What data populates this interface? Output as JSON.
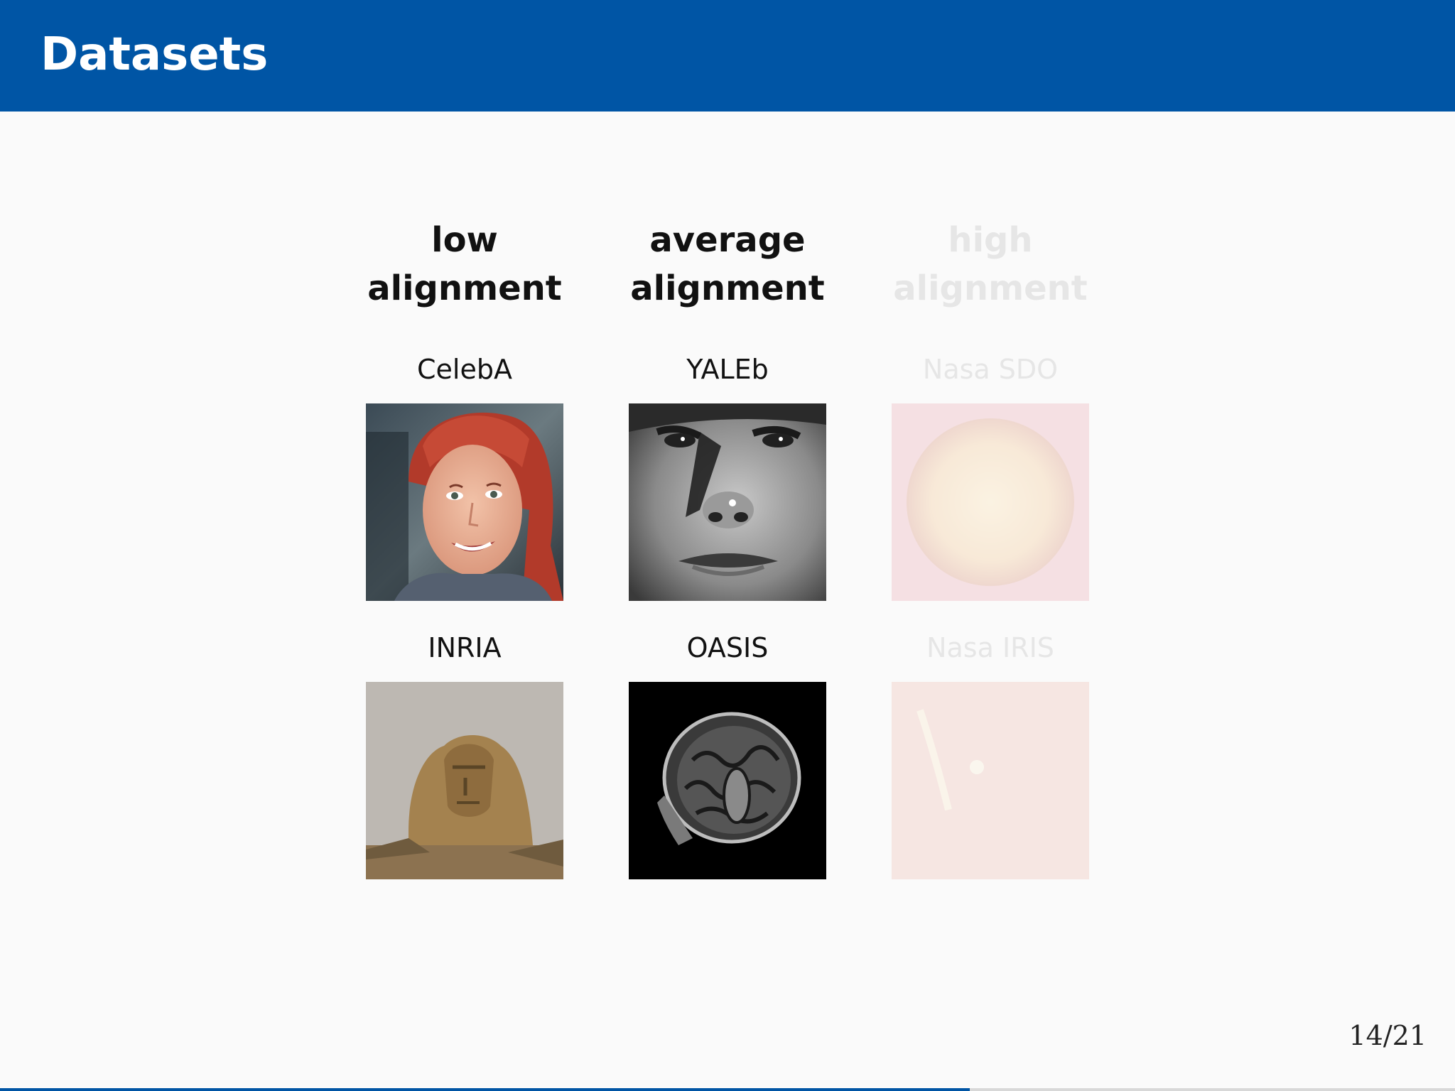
{
  "slide": {
    "title": "Datasets",
    "page_number": "14/21",
    "progress": 0.6667
  },
  "columns": [
    {
      "heading_line1": "low",
      "heading_line2": "alignment",
      "highlighted": true,
      "datasets": [
        {
          "name": "CelebA",
          "image": "woman-face-photo"
        },
        {
          "name": "INRIA",
          "image": "sphinx-photo"
        }
      ]
    },
    {
      "heading_line1": "average",
      "heading_line2": "alignment",
      "highlighted": true,
      "datasets": [
        {
          "name": "YALEb",
          "image": "grayscale-face-photo"
        },
        {
          "name": "OASIS",
          "image": "brain-mri-scan"
        }
      ]
    },
    {
      "heading_line1": "high",
      "heading_line2": "alignment",
      "highlighted": false,
      "datasets": [
        {
          "name": "Nasa SDO",
          "image": "sun-image"
        },
        {
          "name": "Nasa IRIS",
          "image": "solar-surface-image"
        }
      ]
    }
  ],
  "colors": {
    "header": "#0055a5",
    "text": "#111111",
    "faded_text": "#e6e6e6"
  }
}
